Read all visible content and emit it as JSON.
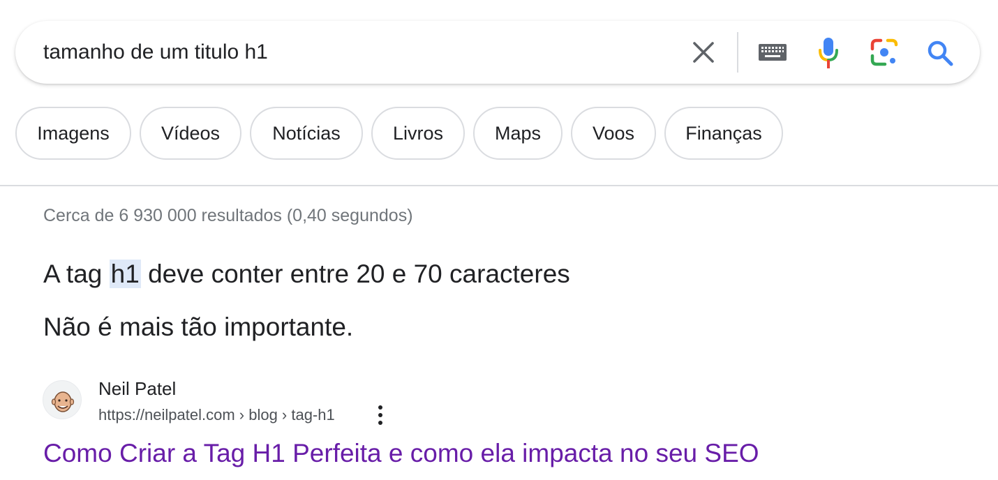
{
  "search": {
    "query": "tamanho de um titulo h1",
    "icons": [
      "close-icon",
      "keyboard-icon",
      "microphone-icon",
      "google-lens-icon",
      "search-icon"
    ]
  },
  "chips": [
    {
      "label": "Imagens"
    },
    {
      "label": "Vídeos"
    },
    {
      "label": "Notícias"
    },
    {
      "label": "Livros"
    },
    {
      "label": "Maps"
    },
    {
      "label": "Voos"
    },
    {
      "label": "Finanças"
    }
  ],
  "results_stats": "Cerca de 6 930 000 resultados (0,40 segundos)",
  "featured": {
    "line1_before": "A tag ",
    "line1_highlight": "h1",
    "line1_after": " deve conter entre 20 e 70 caracteres",
    "line2": "Não é mais tão importante."
  },
  "result": {
    "site_name": "Neil Patel",
    "url": "https://neilpatel.com › blog › tag-h1",
    "title": "Como Criar a Tag H1 Perfeita e como ela impacta no seu SEO"
  },
  "colors": {
    "link_visited": "#681da8",
    "search_blue": "#4285f4",
    "highlight": "#dfe9f8",
    "meta_gray": "#70757a"
  }
}
